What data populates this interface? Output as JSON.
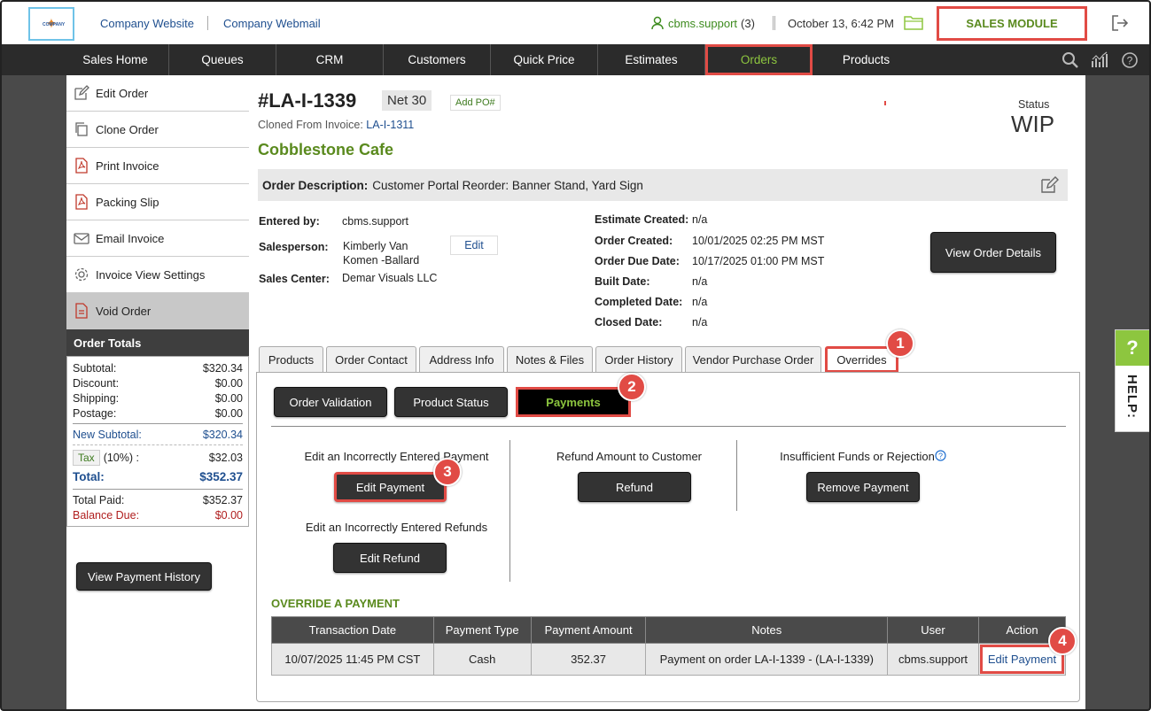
{
  "header": {
    "logo_text": "COMPANY",
    "company_website": "Company Website",
    "company_webmail": "Company Webmail",
    "user": "cbms.support",
    "user_count": "(3)",
    "datetime": "October 13, 6:42 PM",
    "module": "SALES MODULE"
  },
  "nav": [
    "Sales Home",
    "Queues",
    "CRM",
    "Customers",
    "Quick Price",
    "Estimates",
    "Orders",
    "Products"
  ],
  "sidebar": {
    "items": [
      "Edit Order",
      "Clone Order",
      "Print Invoice",
      "Packing Slip",
      "Email Invoice",
      "Invoice View Settings",
      "Void Order"
    ],
    "totals_title": "Order Totals",
    "subtotal_label": "Subtotal:",
    "subtotal": "$320.34",
    "discount_label": "Discount:",
    "discount": "$0.00",
    "shipping_label": "Shipping:",
    "shipping": "$0.00",
    "postage_label": "Postage:",
    "postage": "$0.00",
    "new_subtotal_label": "New Subtotal:",
    "new_subtotal": "$320.34",
    "tax_label": "Tax",
    "tax_rate": "(10%) :",
    "tax": "$32.03",
    "total_label": "Total:",
    "total": "$352.37",
    "paid_label": "Total Paid:",
    "paid": "$352.37",
    "balance_label": "Balance Due:",
    "balance": "$0.00",
    "payment_history_btn": "View Payment History"
  },
  "order": {
    "id": "#LA-I-1339",
    "terms": "Net 30",
    "add_po": "Add PO#",
    "cloned_label": "Cloned From Invoice:",
    "cloned_link": "LA-I-1311",
    "customer": "Cobblestone Cafe",
    "status_label": "Status",
    "status": "WIP",
    "desc_label": "Order Description:",
    "desc": "Customer Portal Reorder: Banner Stand, Yard Sign",
    "entered_by_label": "Entered by:",
    "entered_by": "cbms.support",
    "salesperson_label": "Salesperson:",
    "salesperson_1": "Kimberly Van",
    "salesperson_2": "Komen -Ballard",
    "edit": "Edit",
    "sales_center_label": "Sales Center:",
    "sales_center": "Demar Visuals LLC",
    "estimate_created_label": "Estimate Created:",
    "estimate_created": "n/a",
    "order_created_label": "Order Created:",
    "order_created": "10/01/2025 02:25 PM MST",
    "due_date_label": "Order Due Date:",
    "due_date": "10/17/2025 01:00 PM MST",
    "built_label": "Built Date:",
    "built": "n/a",
    "completed_label": "Completed Date:",
    "completed": "n/a",
    "closed_label": "Closed Date:",
    "closed": "n/a",
    "view_details": "View Order Details"
  },
  "tabs": [
    "Products",
    "Order Contact",
    "Address Info",
    "Notes & Files",
    "Order History",
    "Vendor Purchase Order",
    "Overrides"
  ],
  "overrides": {
    "subtabs": [
      "Order Validation",
      "Product Status",
      "Payments"
    ],
    "edit_payment_caption": "Edit an Incorrectly Entered Payment",
    "edit_payment_btn": "Edit Payment",
    "edit_refund_caption": "Edit an Incorrectly Entered Refunds",
    "edit_refund_btn": "Edit Refund",
    "refund_caption": "Refund Amount to Customer",
    "refund_btn": "Refund",
    "remove_caption": "Insufficient Funds or Rejection",
    "remove_btn": "Remove Payment",
    "override_title": "OVERRIDE A PAYMENT",
    "columns": [
      "Transaction Date",
      "Payment Type",
      "Payment Amount",
      "Notes",
      "User",
      "Action"
    ],
    "row": {
      "date": "10/07/2025 11:45 PM CST",
      "type": "Cash",
      "amount": "352.37",
      "notes": "Payment on order LA-I-1339 - (LA-I-1339)",
      "user": "cbms.support",
      "action": "Edit Payment"
    }
  },
  "markers": [
    "1",
    "2",
    "3",
    "4"
  ],
  "help": {
    "q": "?",
    "label": "HELP:"
  },
  "colors": {
    "accent_green": "#8dc63f",
    "brand_green": "#5a8a1e",
    "highlight_red": "#e14b45",
    "link_blue": "#1f4f8f"
  }
}
